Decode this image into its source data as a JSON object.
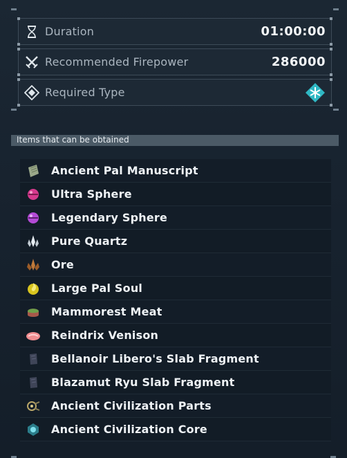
{
  "info": {
    "duration": {
      "label": "Duration",
      "value": "01:00:00",
      "icon": "hourglass-icon"
    },
    "firepower": {
      "label": "Recommended Firepower",
      "value": "286000",
      "icon": "crossed-swords-icon"
    },
    "required_type": {
      "label": "Required Type",
      "icon": "diamond-icon",
      "type_icon": "ice-type-icon",
      "type_color": "#2fb8c4"
    }
  },
  "items_section": {
    "title": "Items that can be obtained",
    "items": [
      {
        "label": "Ancient Pal Manuscript",
        "icon": "manuscript-icon"
      },
      {
        "label": "Ultra Sphere",
        "icon": "ultra-sphere-icon"
      },
      {
        "label": "Legendary Sphere",
        "icon": "legendary-sphere-icon"
      },
      {
        "label": "Pure Quartz",
        "icon": "quartz-icon"
      },
      {
        "label": "Ore",
        "icon": "ore-icon"
      },
      {
        "label": "Large Pal Soul",
        "icon": "pal-soul-icon"
      },
      {
        "label": "Mammorest Meat",
        "icon": "meat-icon"
      },
      {
        "label": "Reindrix Venison",
        "icon": "venison-icon"
      },
      {
        "label": "Bellanoir Libero's Slab Fragment",
        "icon": "slab-fragment-icon"
      },
      {
        "label": "Blazamut Ryu Slab Fragment",
        "icon": "slab-fragment-icon"
      },
      {
        "label": "Ancient Civilization Parts",
        "icon": "civilization-parts-icon"
      },
      {
        "label": "Ancient Civilization Core",
        "icon": "civilization-core-icon"
      }
    ]
  }
}
